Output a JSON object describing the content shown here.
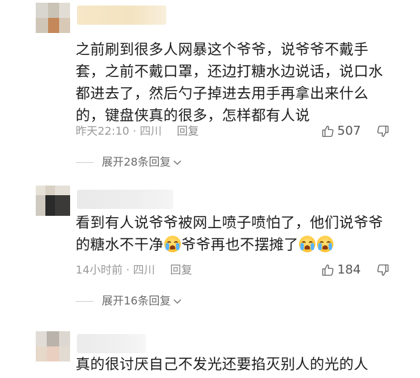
{
  "comments": [
    {
      "text_lines": [
        "之前刷到很多人网暴这个爷爷，说爷爷不戴手",
        "套，之前不戴口罩，还边打糖水边说话，说口水",
        "都进去了，然后勺子掉进去用手再拿出来什么",
        "的，键盘侠真的很多，怎样都有人说"
      ],
      "time": "昨天22:10",
      "location": "四川",
      "reply_label": "回复",
      "likes": "507",
      "expand_label": "展开28条回复"
    },
    {
      "text_line1": "看到有人说爷爷被网上喷子喷怕了，他们说爷爷",
      "text_line2_a": "的糖水不干净",
      "text_line2_b": "爷爷再也不摆摊了",
      "time": "14小时前",
      "location": "四川",
      "reply_label": "回复",
      "likes": "184",
      "expand_label": "展开16条回复"
    },
    {
      "text_lines": [
        "真的很讨厌自己不发光还要掐灭别人的光的人"
      ]
    }
  ],
  "icons": {
    "like": "thumbs-up-icon",
    "dislike": "thumbs-down-icon",
    "expand": "chevron-down-icon",
    "emoji": "crying-face-emoji"
  },
  "colors": {
    "text": "#1c1c1c",
    "meta": "#9a9a9a",
    "expand": "#6b6b6b",
    "emoji": "#ffc93c"
  }
}
